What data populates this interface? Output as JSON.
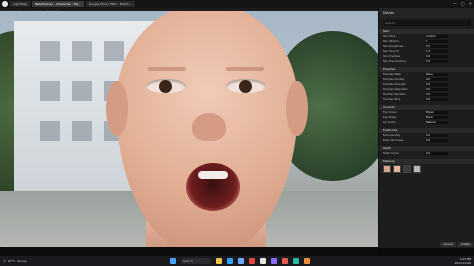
{
  "window": {
    "tabs": [
      {
        "label": "LightMap",
        "active": false
      },
      {
        "label": "MetaHuman - Character - My...",
        "active": true
      },
      {
        "label": "Google Photo FIBO - Metah...",
        "active": false
      }
    ],
    "controls": [
      "—",
      "▢",
      "✕"
    ]
  },
  "toolbar": {
    "buttons": [
      "Perspective",
      "Lit",
      "Show"
    ]
  },
  "viewport": {
    "axis_label": "⊥"
  },
  "details_panel": {
    "title": "Details",
    "search_placeholder": "Search",
    "sections": [
      {
        "title": "Skin",
        "props": [
          {
            "label": "Skin Tone",
            "value": "Custom"
          },
          {
            "label": "Skin Texture",
            "value": "1"
          },
          {
            "label": "Skin Roughness",
            "value": "0.5"
          },
          {
            "label": "Skin Tone UI",
            "value": "1.0"
          },
          {
            "label": "Skin Freckles",
            "value": "0.0"
          },
          {
            "label": "Skin Translucency",
            "value": "0.5"
          }
        ]
      },
      {
        "title": "Freckles",
        "props": [
          {
            "label": "Freckles Mask",
            "value": "None"
          },
          {
            "label": "Freckles Density",
            "value": "0.0"
          },
          {
            "label": "Freckles Strength",
            "value": "0.0"
          },
          {
            "label": "Freckles Saturation",
            "value": "0.0"
          },
          {
            "label": "Freckles Variation",
            "value": "0.0"
          },
          {
            "label": "Freckles Tone",
            "value": "0.0"
          }
        ]
      },
      {
        "title": "Accents",
        "props": [
          {
            "label": "Eye Colour",
            "value": "Brown"
          },
          {
            "label": "Eye Shape",
            "value": "None"
          },
          {
            "label": "Lip Colour",
            "value": "Natural"
          }
        ]
      },
      {
        "title": "Eyebrows",
        "props": [
          {
            "label": "Brow Density",
            "value": "0.0"
          },
          {
            "label": "Brow Thickness",
            "value": "0.0"
          }
        ]
      },
      {
        "title": "Teeth",
        "props": [
          {
            "label": "Teeth Colour",
            "value": "0.0"
          }
        ]
      },
      {
        "title": "Makeup",
        "props": []
      }
    ],
    "swatches": [
      "#d7a58d",
      "#e2b59d",
      "#3a3a3a",
      "#b7b7b7"
    ],
    "footer_buttons": [
      "Cancel",
      "Create"
    ]
  },
  "taskbar": {
    "weather_temp": "21°C",
    "weather_desc": "Sunny",
    "search_label": "Search",
    "app_icons": [
      {
        "name": "windows-logo-icon",
        "color": "#4aa3ff"
      },
      {
        "name": "file-explorer-icon",
        "color": "#f2c14e"
      },
      {
        "name": "edge-browser-icon",
        "color": "#2fa4ff"
      },
      {
        "name": "store-icon",
        "color": "#6aa9ff"
      },
      {
        "name": "chrome-icon",
        "color": "#e4463c"
      },
      {
        "name": "unreal-engine-icon",
        "color": "#e6e6e6"
      },
      {
        "name": "app-purple-icon",
        "color": "#8b6bff"
      },
      {
        "name": "app-red-icon",
        "color": "#e05a4f"
      },
      {
        "name": "app-teal-icon",
        "color": "#2bb7a3"
      },
      {
        "name": "app-orange-icon",
        "color": "#f0913a"
      }
    ],
    "time": "4:23 PM",
    "date": "2023-10-06"
  }
}
